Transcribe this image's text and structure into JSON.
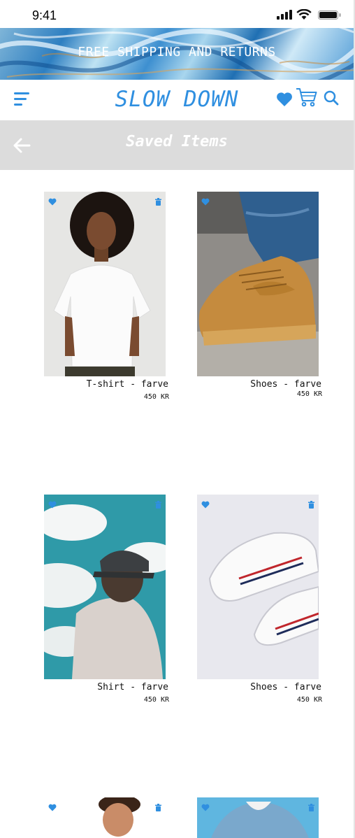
{
  "status_bar": {
    "time": "9:41"
  },
  "banner": {
    "text": "FREE SHIPPING AND RETURNS"
  },
  "header": {
    "logo": "SLOW DOWN"
  },
  "page": {
    "title": "Saved Items"
  },
  "colors": {
    "accent": "#2f8fe0",
    "title_bar": "#dcdcdc"
  },
  "products": [
    {
      "name": "T-shirt - farve",
      "price": "450 KR"
    },
    {
      "name": "Shoes - farve",
      "price": "450 KR"
    },
    {
      "name": "Shirt - farve",
      "price": "450 KR"
    },
    {
      "name": "Shoes - farve",
      "price": "450 KR"
    }
  ]
}
